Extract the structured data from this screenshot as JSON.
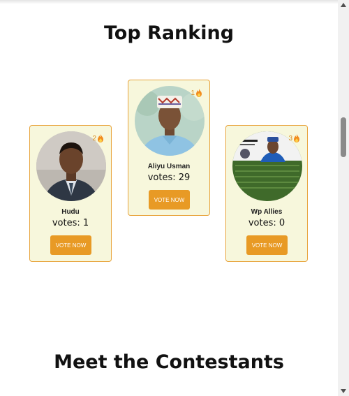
{
  "sections": {
    "ranking_title": "Top Ranking",
    "contestants_title": "Meet the Contestants"
  },
  "ranking": [
    {
      "rank": "1",
      "name": "Aliyu Usman",
      "votes": "votes: 29",
      "button": "VOTE NOW",
      "icon": "flame-icon"
    },
    {
      "rank": "2",
      "name": "Hudu",
      "votes": "votes: 1",
      "button": "VOTE NOW",
      "icon": "flame-icon"
    },
    {
      "rank": "3",
      "name": "Wp Allies",
      "votes": "votes: 0",
      "button": "VOTE NOW",
      "icon": "flame-icon"
    }
  ],
  "colors": {
    "accent": "#e89a25",
    "card_bg": "#f7f7dc",
    "card_border": "#e8a33a",
    "rank_text": "#d88a1e"
  }
}
